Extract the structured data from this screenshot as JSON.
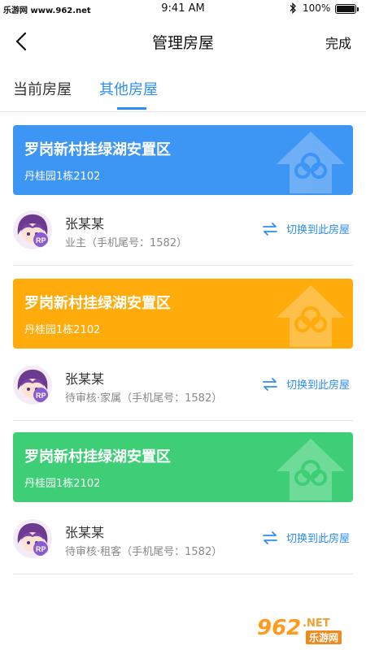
{
  "status_bar": {
    "carrier": "乐游网 www.962.net",
    "time": "9:41 AM",
    "battery": "100%"
  },
  "nav": {
    "title": "管理房屋",
    "done_label": "完成"
  },
  "tabs": [
    {
      "label": "当前房屋",
      "active": false
    },
    {
      "label": "其他房屋",
      "active": true
    }
  ],
  "houses": [
    {
      "name": "罗岗新村挂绿湖安置区",
      "address": "丹桂园1栋2102",
      "color": "#3d95f4",
      "person": {
        "name": "张某某",
        "desc": "业主（手机尾号：1582）"
      },
      "switch_label": "切换到此房屋"
    },
    {
      "name": "罗岗新村挂绿湖安置区",
      "address": "丹桂园1栋2102",
      "color": "#ffab0c",
      "person": {
        "name": "张某某",
        "desc": "待审核·家属（手机尾号：1582）"
      },
      "switch_label": "切换到此房屋"
    },
    {
      "name": "罗岗新村挂绿湖安置区",
      "address": "丹桂园1栋2102",
      "color": "#3ecf76",
      "person": {
        "name": "张某某",
        "desc": "待审核·租客（手机尾号：1582）"
      },
      "switch_label": "切换到此房屋"
    }
  ],
  "watermark": {
    "number": "962",
    "suffix": ".NET",
    "text": "乐游网"
  },
  "icons": {
    "back": "chevron-left-icon",
    "switch": "swap-arrows-icon",
    "bluetooth": "bluetooth-icon",
    "battery": "battery-icon"
  },
  "accent_color": "#2b8ef0"
}
